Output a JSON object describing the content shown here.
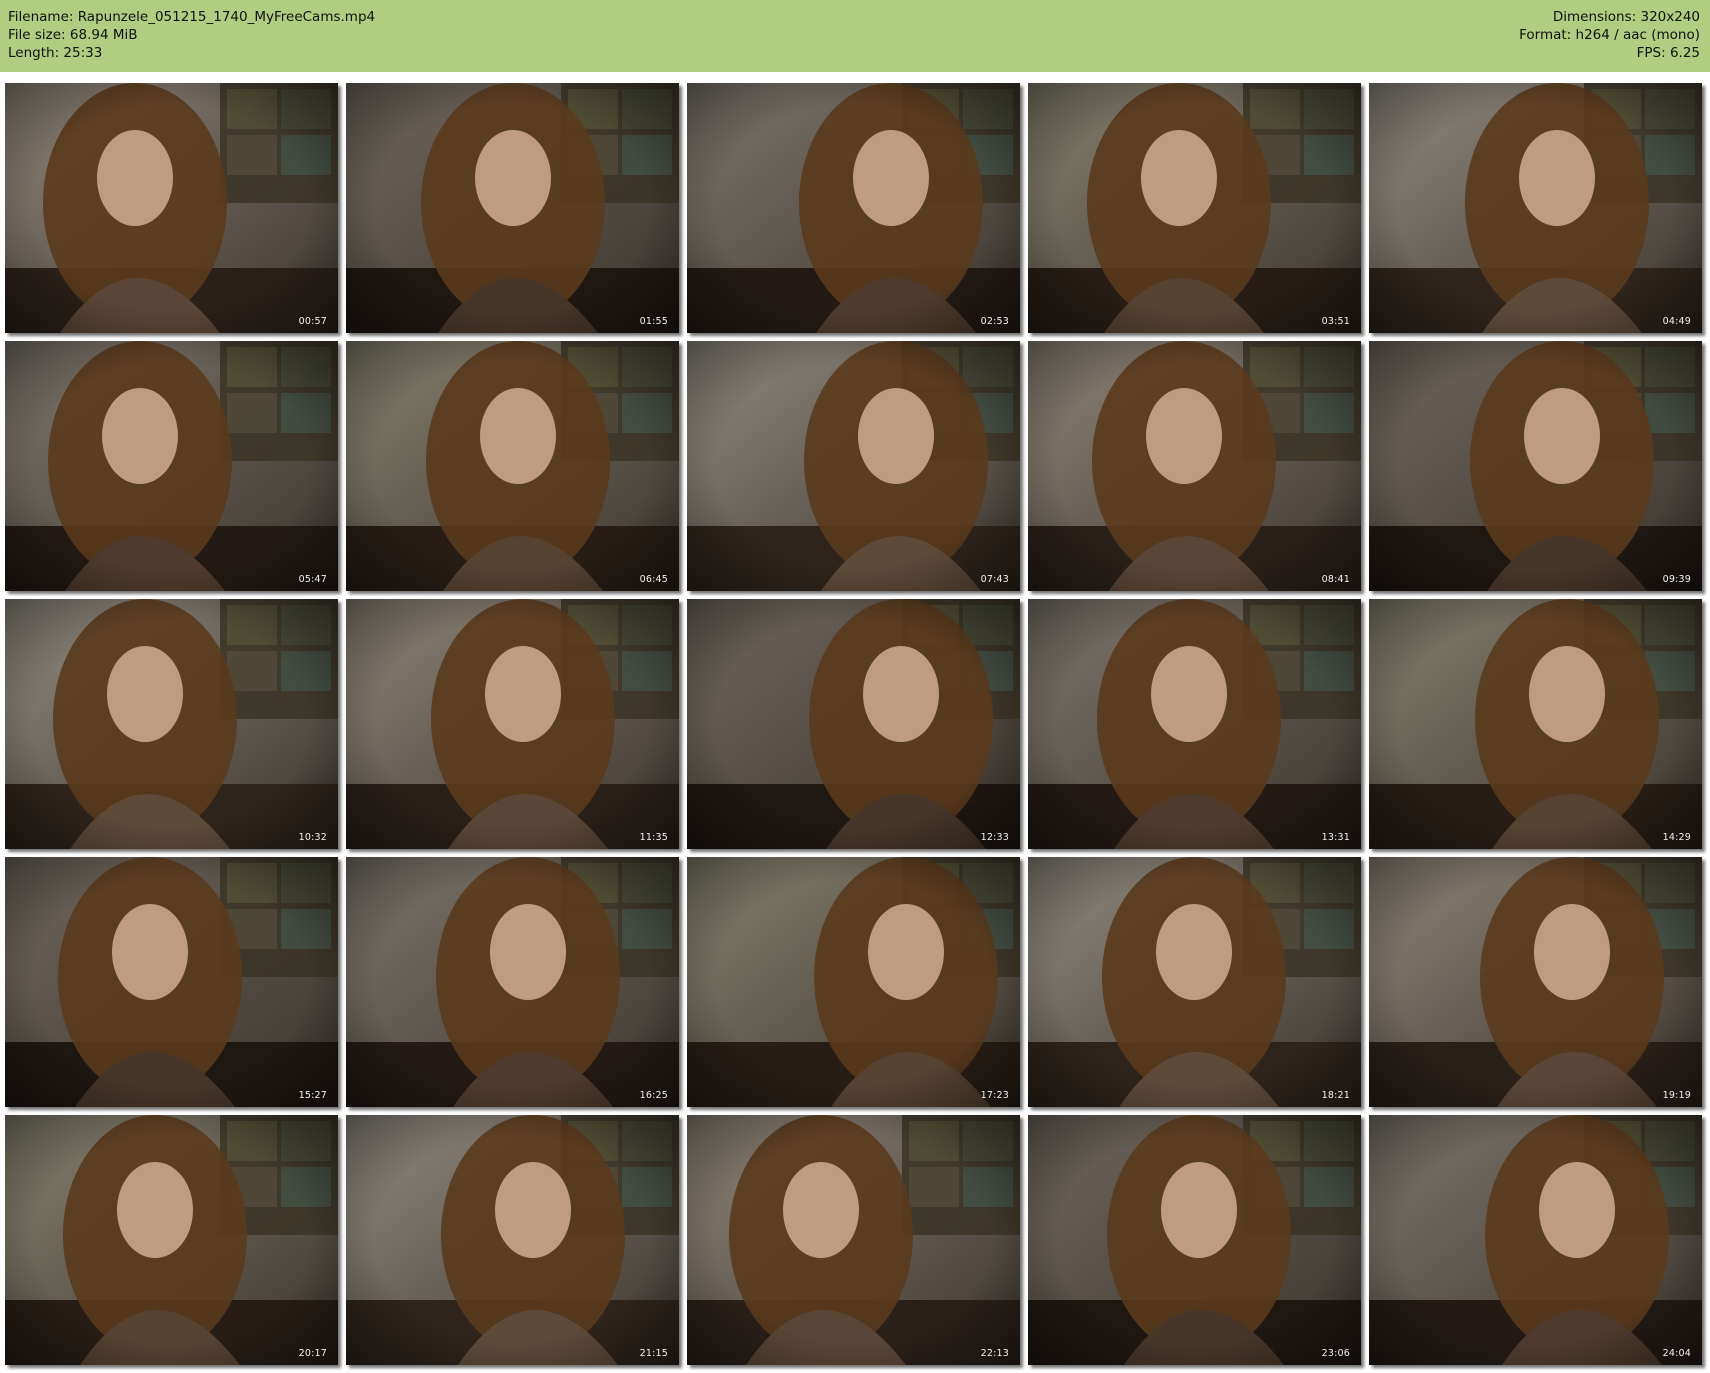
{
  "header": {
    "filename_line": "Filename: Rapunzele_051215_1740_MyFreeCams.mp4",
    "filesize_line": "File size: 68.94 MiB",
    "length_line": "Length: 25:33",
    "dimensions_line": "Dimensions: 320x240",
    "format_line": "Format: h264 / aac (mono)",
    "fps_line": "FPS: 6.25"
  },
  "colors": {
    "header_background": "#b0cd82"
  },
  "thumbnails": [
    {
      "time": "00:57",
      "icon": "video-frame-thumbnail"
    },
    {
      "time": "01:55",
      "icon": "video-frame-thumbnail"
    },
    {
      "time": "02:53",
      "icon": "video-frame-thumbnail"
    },
    {
      "time": "03:51",
      "icon": "video-frame-thumbnail"
    },
    {
      "time": "04:49",
      "icon": "video-frame-thumbnail"
    },
    {
      "time": "05:47",
      "icon": "video-frame-thumbnail"
    },
    {
      "time": "06:45",
      "icon": "video-frame-thumbnail"
    },
    {
      "time": "07:43",
      "icon": "video-frame-thumbnail"
    },
    {
      "time": "08:41",
      "icon": "video-frame-thumbnail"
    },
    {
      "time": "09:39",
      "icon": "video-frame-thumbnail"
    },
    {
      "time": "10:32",
      "icon": "video-frame-thumbnail"
    },
    {
      "time": "11:35",
      "icon": "video-frame-thumbnail"
    },
    {
      "time": "12:33",
      "icon": "video-frame-thumbnail"
    },
    {
      "time": "13:31",
      "icon": "video-frame-thumbnail"
    },
    {
      "time": "14:29",
      "icon": "video-frame-thumbnail"
    },
    {
      "time": "15:27",
      "icon": "video-frame-thumbnail"
    },
    {
      "time": "16:25",
      "icon": "video-frame-thumbnail"
    },
    {
      "time": "17:23",
      "icon": "video-frame-thumbnail"
    },
    {
      "time": "18:21",
      "icon": "video-frame-thumbnail"
    },
    {
      "time": "19:19",
      "icon": "video-frame-thumbnail"
    },
    {
      "time": "20:17",
      "icon": "video-frame-thumbnail"
    },
    {
      "time": "21:15",
      "icon": "video-frame-thumbnail"
    },
    {
      "time": "22:13",
      "icon": "video-frame-thumbnail"
    },
    {
      "time": "23:06",
      "icon": "video-frame-thumbnail"
    },
    {
      "time": "24:04",
      "icon": "video-frame-thumbnail"
    }
  ]
}
